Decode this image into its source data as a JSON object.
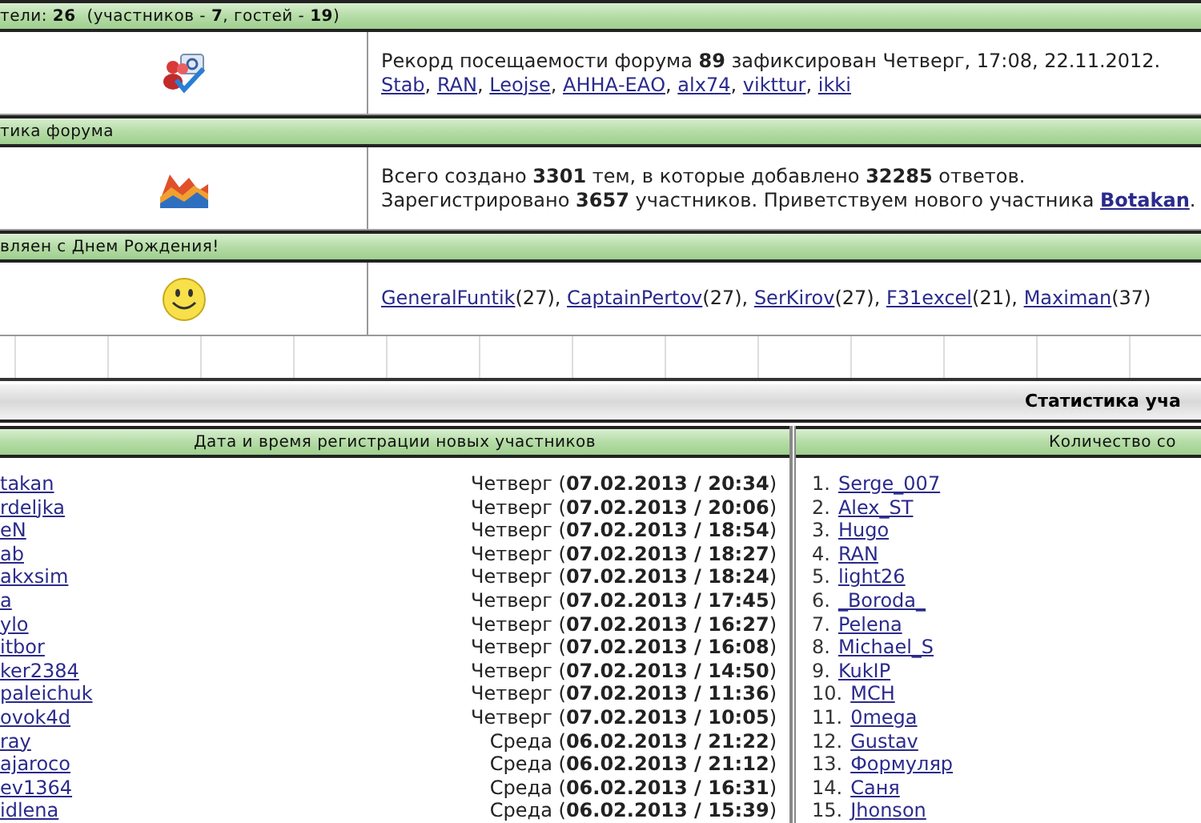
{
  "online_bar": {
    "text": "тели: **26**  (участников - **7**, гостей - **19**)"
  },
  "record": {
    "text": "Рекорд посещаемости форума **89** зафиксирован Четверг, 17:08, 22.11.2012.",
    "users": [
      {
        "name": "Stab",
        "after": ","
      },
      {
        "name": "RAN",
        "after": ","
      },
      {
        "name": "Leojse",
        "after": ","
      },
      {
        "name": "АННА-ЕАО",
        "after": ","
      },
      {
        "name": "alx74",
        "after": ","
      },
      {
        "name": "vikttur",
        "after": ","
      },
      {
        "name": "ikki"
      }
    ]
  },
  "stats_header": "тика форума",
  "stats": {
    "line1": "Всего создано **3301** тем, в которые добавлено **32285** ответов.",
    "line2": "Зарегистрировано **3657** участников. Приветствуем нового участника",
    "newest_user": "Botakan",
    "after": "."
  },
  "birthday_header": "вляен с Днем Рождения!",
  "birthdays": [
    {
      "name": "GeneralFuntik",
      "after": "(27),"
    },
    {
      "name": "CaptainPertov",
      "after": "(27),"
    },
    {
      "name": "SerKirov",
      "after": "(27),"
    },
    {
      "name": "F31excel",
      "after": "(21),"
    },
    {
      "name": "Maximan",
      "after": "(37)"
    }
  ],
  "statistics_title": "Статистика уча",
  "registrations": {
    "heading": "Дата и время регистрации новых участников",
    "rows": [
      {
        "user": "takan",
        "date": "Четверг (**07.02.2013 / 20:34**)"
      },
      {
        "user": "rdeljka",
        "date": "Четверг (**07.02.2013 / 20:06**)"
      },
      {
        "user": "eN",
        "date": "Четверг (**07.02.2013 / 18:54**)"
      },
      {
        "user": "ab",
        "date": "Четверг (**07.02.2013 / 18:27**)"
      },
      {
        "user": "akxsim",
        "date": "Четверг (**07.02.2013 / 18:24**)"
      },
      {
        "user": "a",
        "date": "Четверг (**07.02.2013 / 17:45**)"
      },
      {
        "user": "ylo",
        "date": "Четверг (**07.02.2013 / 16:27**)"
      },
      {
        "user": "itbor",
        "date": "Четверг (**07.02.2013 / 16:08**)"
      },
      {
        "user": "ker2384",
        "date": "Четверг (**07.02.2013 / 14:50**)"
      },
      {
        "user": "paleichuk",
        "date": "Четверг (**07.02.2013 / 11:36**)"
      },
      {
        "user": "ovok4d",
        "date": "Четверг (**07.02.2013 / 10:05**)"
      },
      {
        "user": "ray",
        "date": "Среда (**06.02.2013 / 21:22**)"
      },
      {
        "user": "ajaroco",
        "date": "Среда (**06.02.2013 / 21:12**)"
      },
      {
        "user": "ev1364",
        "date": "Среда (**06.02.2013 / 16:31**)"
      },
      {
        "user": "idlena",
        "date": "Среда (**06.02.2013 / 15:39**)"
      }
    ]
  },
  "top_posters": {
    "heading": "Количество со",
    "rows": [
      {
        "rank": "1.",
        "user": "Serge_007"
      },
      {
        "rank": "2.",
        "user": "Alex_ST"
      },
      {
        "rank": "3.",
        "user": "Hugo"
      },
      {
        "rank": "4.",
        "user": "RAN"
      },
      {
        "rank": "5.",
        "user": "light26"
      },
      {
        "rank": "6.",
        "user": "_Boroda_"
      },
      {
        "rank": "7.",
        "user": "Pelena"
      },
      {
        "rank": "8.",
        "user": "Michael_S"
      },
      {
        "rank": "9.",
        "user": "KukIP"
      },
      {
        "rank": "10.",
        "user": "MCH"
      },
      {
        "rank": "11.",
        "user": "0mega"
      },
      {
        "rank": "12.",
        "user": "Gustav"
      },
      {
        "rank": "13.",
        "user": "Формуляр"
      },
      {
        "rank": "14.",
        "user": "Саня"
      },
      {
        "rank": "15.",
        "user": "Jhonson"
      }
    ]
  }
}
